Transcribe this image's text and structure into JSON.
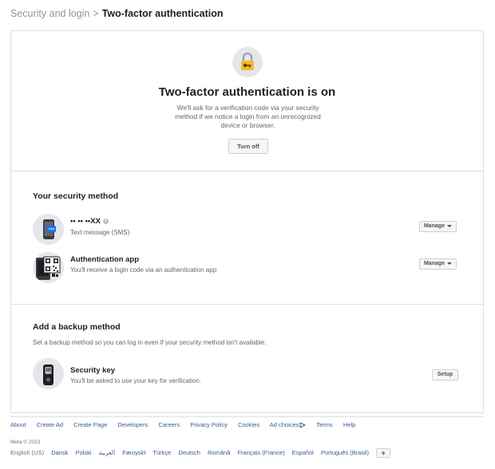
{
  "breadcrumb": {
    "parent": "Security and login",
    "separator": ">",
    "current": "Two-factor authentication"
  },
  "hero": {
    "icon": "padlock-key-icon",
    "title": "Two-factor authentication is on",
    "description": "We'll ask for a verification code via your security method if we notice a login from an unrecognized device or browser.",
    "turn_off_label": "Turn off"
  },
  "security_method": {
    "title": "Your security method",
    "items": [
      {
        "icon": "phone-sms-icon",
        "title": "•• •• ••XX",
        "info_glyph": "i",
        "subtitle": "Text message (SMS)",
        "button_label": "Manage"
      },
      {
        "icon": "qr-phone-icon",
        "title": "Authentication app",
        "subtitle": "You'll receive a login code via an authentication app",
        "button_label": "Manage"
      }
    ]
  },
  "backup": {
    "title": "Add a backup method",
    "description": "Set a backup method so you can log in even if your security method isn't available.",
    "item": {
      "icon": "security-key-icon",
      "title": "Security key",
      "subtitle": "You'll be asked to use your key for verification.",
      "button_label": "Setup"
    }
  },
  "footer": {
    "links": [
      "About",
      "Create Ad",
      "Create Page",
      "Developers",
      "Careers",
      "Privacy Policy",
      "Cookies",
      "Ad choices",
      "Terms",
      "Help"
    ],
    "copyright": "Meta © 2023",
    "current_language": "English (US)",
    "languages": [
      "Dansk",
      "Polski",
      "العربية",
      "Føroyskt",
      "Türkçe",
      "Deutsch",
      "Română",
      "Français (France)",
      "Español",
      "Português (Brasil)"
    ],
    "more_languages_glyph": "+"
  },
  "colors": {
    "link": "#385898",
    "border": "#dddfe2",
    "muted_text": "#606770",
    "accent_yellow": "#f7b928",
    "sms_blue": "#1877f2"
  }
}
